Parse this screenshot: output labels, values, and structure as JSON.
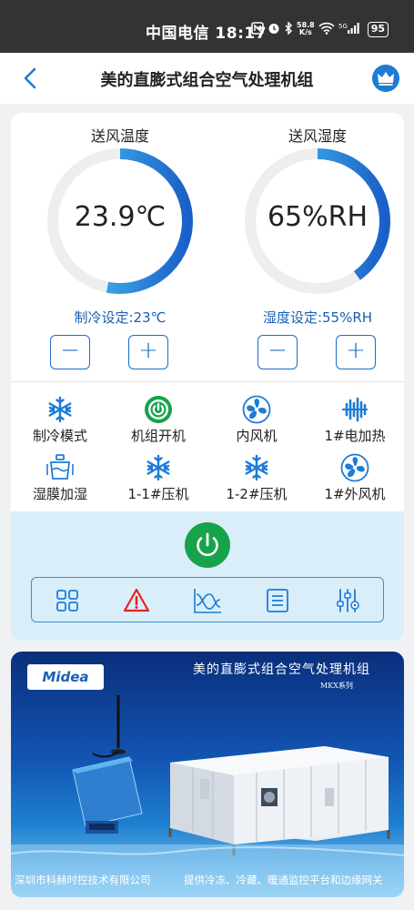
{
  "status_bar": {
    "carrier_time": "中国电信 18:17",
    "net_speed_top": "58.8",
    "net_speed_bottom": "K/s",
    "signal_label": "5G",
    "battery": "95"
  },
  "header": {
    "title": "美的直膨式组合空气处理机组"
  },
  "gauges": [
    {
      "title": "送风温度",
      "value": "23.9℃",
      "setting": "制冷设定:23℃",
      "fill_fraction": 0.53
    },
    {
      "title": "送风湿度",
      "value": "65%RH",
      "setting": "湿度设定:55%RH",
      "fill_fraction": 0.4
    }
  ],
  "stepper": {
    "minus": "−",
    "plus": "+"
  },
  "modes": [
    {
      "label": "制冷模式",
      "icon": "snowflake-icon"
    },
    {
      "label": "机组开机",
      "icon": "power-on-icon"
    },
    {
      "label": "内风机",
      "icon": "fan-icon"
    },
    {
      "label": "1#电加热",
      "icon": "heater-icon"
    },
    {
      "label": "湿膜加湿",
      "icon": "humidifier-icon"
    },
    {
      "label": "1-1#压机",
      "icon": "snowflake-icon"
    },
    {
      "label": "1-2#压机",
      "icon": "snowflake-icon"
    },
    {
      "label": "1#外风机",
      "icon": "fan-icon"
    }
  ],
  "toolbar": [
    "grid-icon",
    "alarm-icon",
    "trend-icon",
    "list-icon",
    "settings-icon"
  ],
  "banner": {
    "logo": "Midea",
    "title": "美的直膨式组合空气处理机组",
    "subtitle": "MKX系列",
    "footer_left": "深圳市科赫时控技术有限公司",
    "footer_right": "提供冷冻、冷藏、暖通监控平台和边缘网关"
  },
  "colors": {
    "accent": "#1a6fc9",
    "power_green": "#16a34a",
    "alarm_red": "#e02424",
    "control_bg": "#d9eef9",
    "status_bar": "#333333"
  }
}
